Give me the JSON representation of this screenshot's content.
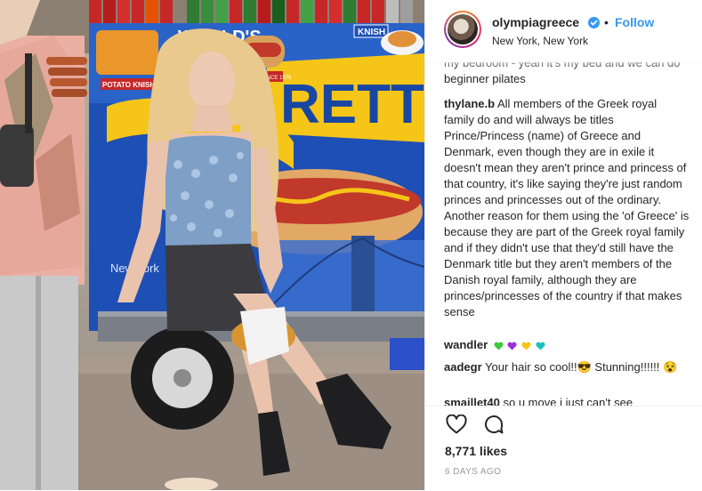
{
  "photo": {
    "sign_top": "WORLD'S",
    "sign_brand": "RETT",
    "sign_corner": "KNISH",
    "sign_potato": "POTATO KNISH",
    "sign_since": "SINCE 1975",
    "sign_city": "New York"
  },
  "header": {
    "handle": "olympiagreece",
    "follow_label": "Follow",
    "dot": "•",
    "location": "New York, New York"
  },
  "comments": [
    {
      "user": "",
      "text": "my bedroom - yeah it's my bed and we can do beginner pilates"
    },
    {
      "user": "thylane.b",
      "text": "All members of the Greek royal family do and will always be titles Prince/Princess (name) of Greece and Denmark, even though they are in exile it doesn't mean they aren't prince and princess of that country, it's like saying they're just random princes and princesses out of the ordinary. Another reason for them using the 'of Greece' is because they are part of the Greek royal family and if they didn't use that they'd still have the Denmark title but they aren't members of the Danish royal family, although they are princes/princesses of the country if that makes sense"
    },
    {
      "user": "wandler",
      "text": ""
    },
    {
      "user": "aadegr",
      "text": "Your hair so cool!!😎 Stunning!!!!!! 😵"
    },
    {
      "user": "smaillet40",
      "text": "so u move i just can't see"
    }
  ],
  "wandler_hearts": [
    "#3cc83c",
    "#9b30d9",
    "#f5c518",
    "#1fbfbf"
  ],
  "actions": {
    "likes": "8,771 likes",
    "time": "6 DAYS AGO"
  },
  "colors": {
    "link": "#3897f0",
    "verified": "#3897f0"
  }
}
